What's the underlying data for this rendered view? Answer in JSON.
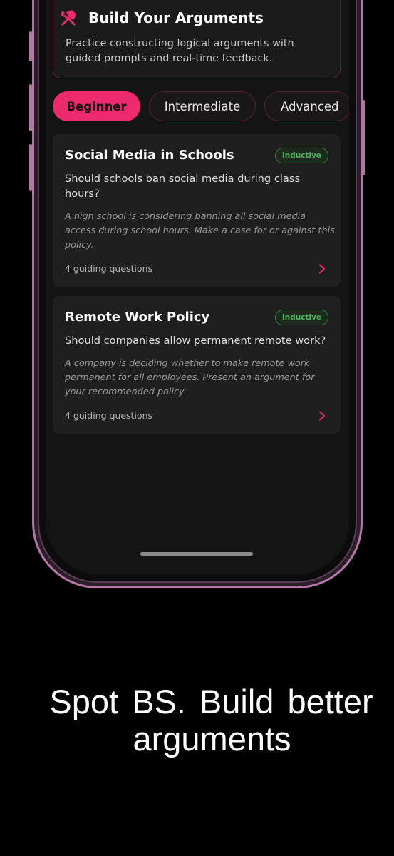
{
  "header": {
    "title": "Build Your Arguments",
    "description": "Practice constructing logical arguments with guided prompts and real-time feedback.",
    "icon": "hammer-wrench-icon",
    "accent_color": "#ee2a6f"
  },
  "tabs": [
    {
      "label": "Beginner",
      "active": true
    },
    {
      "label": "Intermediate",
      "active": false
    },
    {
      "label": "Advanced",
      "active": false
    }
  ],
  "lessons": [
    {
      "title": "Social Media in Schools",
      "badge": "Inductive",
      "question": "Should schools ban social media during class hours?",
      "scenario": "A high school is considering banning all social media access during school hours. Make a case for or against this policy.",
      "meta": "4 guiding questions"
    },
    {
      "title": "Remote Work Policy",
      "badge": "Inductive",
      "question": "Should companies allow permanent remote work?",
      "scenario": "A company is deciding whether to make remote work permanent for all employees. Present an argument for your recommended policy.",
      "meta": "4 guiding questions"
    }
  ],
  "caption": {
    "line1": "Spot BS. Build better",
    "line2": "arguments"
  }
}
